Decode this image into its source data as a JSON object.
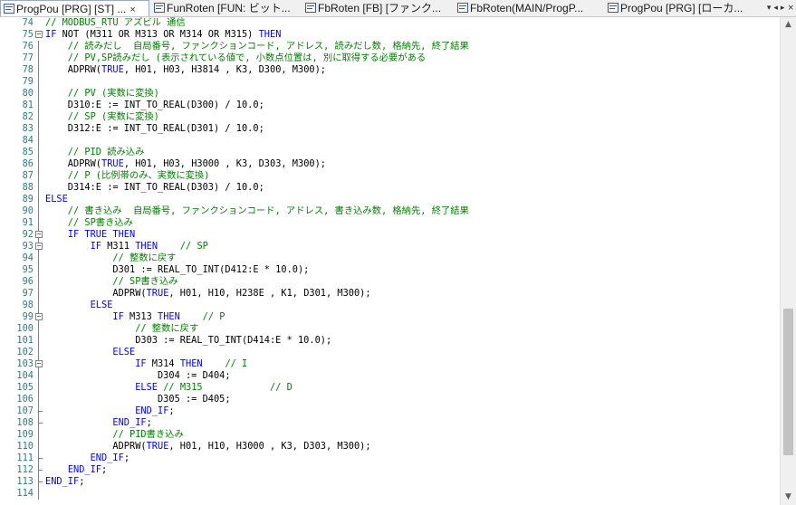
{
  "tabs": [
    {
      "label": "ProgPou [PRG] [ST] ...",
      "close": "×",
      "active": true
    },
    {
      "label": "FunRoten [FUN: ビット...",
      "active": false
    },
    {
      "label": "FbRoten [FB] [ファンク...",
      "active": false
    },
    {
      "label": "FbRoten(MAIN/ProgP...",
      "active": false
    },
    {
      "label": "ProgPou [PRG] [ローカ...",
      "active": false
    }
  ],
  "tab_nav": {
    "dropdown": "▾",
    "left": "◂",
    "right": "▸",
    "close": "×"
  },
  "scrollbar": {
    "up": "▲",
    "down": "▼"
  },
  "colors": {
    "keyword": "#0000ff",
    "comment": "#008000",
    "line_number": "#2b7d8b"
  },
  "lines": [
    {
      "num": "74",
      "code": [
        {
          "t": "// MODBUS_RTU アズビル 通信",
          "c": "cm"
        }
      ]
    },
    {
      "num": "75",
      "code": [
        {
          "t": "IF",
          "c": "kw"
        },
        {
          "t": " NOT (M311 OR M313 OR M314 OR M315) "
        },
        {
          "t": "THEN",
          "c": "kw"
        }
      ]
    },
    {
      "num": "76",
      "code": [
        {
          "t": "    // 読みだし  自局番号, ファンクションコード, アドレス, 読みだし数, 格納先, 終了結果",
          "c": "cm"
        }
      ]
    },
    {
      "num": "77",
      "code": [
        {
          "t": "    // PV,SP読みだし (表示されている値で, 小数点位置は, 別に取得する必要がある",
          "c": "cm"
        }
      ]
    },
    {
      "num": "78",
      "code": [
        {
          "t": "    ADPRW("
        },
        {
          "t": "TRUE",
          "c": "kw"
        },
        {
          "t": ", H01, H03, H3814 , K3, D300, M300);"
        }
      ]
    },
    {
      "num": "79",
      "code": []
    },
    {
      "num": "80",
      "code": [
        {
          "t": "    // PV (実数に変換)",
          "c": "cm"
        }
      ]
    },
    {
      "num": "81",
      "code": [
        {
          "t": "    D310:E := INT_TO_REAL(D300) / 10.0;"
        }
      ]
    },
    {
      "num": "82",
      "code": [
        {
          "t": "    // SP (実数に変換)",
          "c": "cm"
        }
      ]
    },
    {
      "num": "83",
      "code": [
        {
          "t": "    D312:E := INT_TO_REAL(D301) / 10.0;"
        }
      ]
    },
    {
      "num": "84",
      "code": []
    },
    {
      "num": "85",
      "code": [
        {
          "t": "    // PID 読み込み",
          "c": "cm"
        }
      ]
    },
    {
      "num": "86",
      "code": [
        {
          "t": "    ADPRW("
        },
        {
          "t": "TRUE",
          "c": "kw"
        },
        {
          "t": ", H01, H03, H3000 , K3, D303, M300);"
        }
      ]
    },
    {
      "num": "87",
      "code": [
        {
          "t": "    // P (比例帯のみ、実数に変換)",
          "c": "cm"
        }
      ]
    },
    {
      "num": "88",
      "code": [
        {
          "t": "    D314:E := INT_TO_REAL(D303) / 10.0;"
        }
      ]
    },
    {
      "num": "89",
      "code": [
        {
          "t": "ELSE",
          "c": "kw"
        }
      ]
    },
    {
      "num": "90",
      "code": [
        {
          "t": "    // 書き込み  自局番号, ファンクションコード, アドレス, 書き込み数, 格納先, 終了結果",
          "c": "cm"
        }
      ]
    },
    {
      "num": "91",
      "code": [
        {
          "t": "    // SP書き込み",
          "c": "cm"
        }
      ]
    },
    {
      "num": "92",
      "code": [
        {
          "t": "    "
        },
        {
          "t": "IF TRUE THEN",
          "c": "kw"
        }
      ]
    },
    {
      "num": "93",
      "code": [
        {
          "t": "        "
        },
        {
          "t": "IF",
          "c": "kw"
        },
        {
          "t": " M311 "
        },
        {
          "t": "THEN",
          "c": "kw"
        },
        {
          "t": "    "
        },
        {
          "t": "// SP",
          "c": "cm"
        }
      ]
    },
    {
      "num": "94",
      "code": [
        {
          "t": "            // 整数に戻す",
          "c": "cm"
        }
      ]
    },
    {
      "num": "95",
      "code": [
        {
          "t": "            D301 := REAL_TO_INT(D412:E * 10.0);"
        }
      ]
    },
    {
      "num": "96",
      "code": [
        {
          "t": "            // SP書き込み",
          "c": "cm"
        }
      ]
    },
    {
      "num": "97",
      "code": [
        {
          "t": "            ADPRW("
        },
        {
          "t": "TRUE",
          "c": "kw"
        },
        {
          "t": ", H01, H10, H238E , K1, D301, M300);"
        }
      ]
    },
    {
      "num": "98",
      "code": [
        {
          "t": "        "
        },
        {
          "t": "ELSE",
          "c": "kw"
        }
      ]
    },
    {
      "num": "99",
      "code": [
        {
          "t": "            "
        },
        {
          "t": "IF",
          "c": "kw"
        },
        {
          "t": " M313 "
        },
        {
          "t": "THEN",
          "c": "kw"
        },
        {
          "t": "    "
        },
        {
          "t": "// P",
          "c": "cm"
        }
      ]
    },
    {
      "num": "100",
      "code": [
        {
          "t": "                // 整数に戻す",
          "c": "cm"
        }
      ]
    },
    {
      "num": "101",
      "code": [
        {
          "t": "                D303 := REAL_TO_INT(D414:E * 10.0);"
        }
      ]
    },
    {
      "num": "102",
      "code": [
        {
          "t": "            "
        },
        {
          "t": "ELSE",
          "c": "kw"
        }
      ]
    },
    {
      "num": "103",
      "code": [
        {
          "t": "                "
        },
        {
          "t": "IF",
          "c": "kw"
        },
        {
          "t": " M314 "
        },
        {
          "t": "THEN",
          "c": "kw"
        },
        {
          "t": "    "
        },
        {
          "t": "// I",
          "c": "cm"
        }
      ]
    },
    {
      "num": "104",
      "code": [
        {
          "t": "                    D304 := D404;"
        }
      ]
    },
    {
      "num": "105",
      "code": [
        {
          "t": "                "
        },
        {
          "t": "ELSE",
          "c": "kw"
        },
        {
          "t": " "
        },
        {
          "t": "// M315            // D",
          "c": "cm"
        }
      ]
    },
    {
      "num": "106",
      "code": [
        {
          "t": "                    D305 := D405;"
        }
      ]
    },
    {
      "num": "107",
      "code": [
        {
          "t": "                "
        },
        {
          "t": "END_IF",
          "c": "kw"
        },
        {
          "t": ";"
        }
      ]
    },
    {
      "num": "108",
      "code": [
        {
          "t": "            "
        },
        {
          "t": "END_IF",
          "c": "kw"
        },
        {
          "t": ";"
        }
      ]
    },
    {
      "num": "109",
      "code": [
        {
          "t": "            // PID書き込み",
          "c": "cm"
        }
      ]
    },
    {
      "num": "110",
      "code": [
        {
          "t": "            ADPRW("
        },
        {
          "t": "TRUE",
          "c": "kw"
        },
        {
          "t": ", H01, H10, H3000 , K3, D303, M300);"
        }
      ]
    },
    {
      "num": "111",
      "code": [
        {
          "t": "        "
        },
        {
          "t": "END_IF",
          "c": "kw"
        },
        {
          "t": ";"
        }
      ]
    },
    {
      "num": "112",
      "code": [
        {
          "t": "    "
        },
        {
          "t": "END_IF",
          "c": "kw"
        },
        {
          "t": ";"
        }
      ]
    },
    {
      "num": "113",
      "code": [
        {
          "t": "END_IF",
          "c": "kw"
        },
        {
          "t": ";"
        }
      ]
    },
    {
      "num": "114",
      "code": []
    }
  ]
}
